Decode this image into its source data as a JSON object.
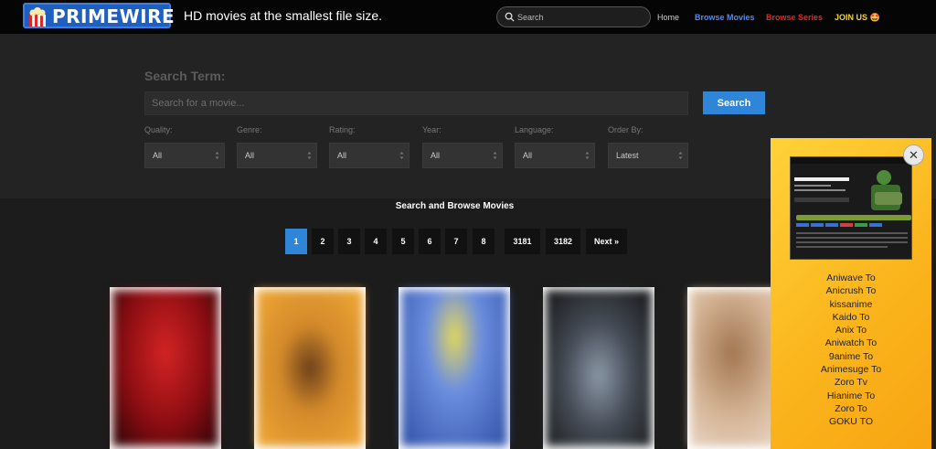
{
  "header": {
    "logo_text": "PRIMEWIRE",
    "tagline": "HD movies at the smallest file size.",
    "search_placeholder": "Search",
    "nav": {
      "home": "Home",
      "browse_movies": "Browse Movies",
      "browse_series": "Browse Series",
      "join": "JOIN US 🤩"
    }
  },
  "search_panel": {
    "term_label": "Search Term:",
    "term_placeholder": "Search for a movie...",
    "search_button": "Search",
    "filters": [
      {
        "label": "Quality:",
        "value": "All"
      },
      {
        "label": "Genre:",
        "value": "All"
      },
      {
        "label": "Rating:",
        "value": "All"
      },
      {
        "label": "Year:",
        "value": "All"
      },
      {
        "label": "Language:",
        "value": "All"
      },
      {
        "label": "Order By:",
        "value": "Latest"
      }
    ]
  },
  "browse": {
    "title": "Search and Browse Movies",
    "pages": [
      "1",
      "2",
      "3",
      "4",
      "5",
      "6",
      "7",
      "8",
      "3181",
      "3182",
      "Next »"
    ],
    "active_page": "1"
  },
  "posters": [
    {
      "color": "#b0141a"
    },
    {
      "color": "#e3a030"
    },
    {
      "color": "#4a6ec0"
    },
    {
      "color": "#556070"
    },
    {
      "color": "#c7a58a"
    }
  ],
  "popup": {
    "close_label": "✕",
    "links": [
      "Aniwave To",
      "Anicrush To",
      "kissanime",
      "Kaido To",
      "Anix To",
      "Aniwatch To",
      "9anime To",
      "Animesuge To",
      "Zoro Tv",
      "Hianime To",
      "Zoro To",
      "GOKU TO"
    ]
  },
  "colors": {
    "accent": "#2f85d8",
    "movies_link": "#4f8bff",
    "series_link": "#e02828",
    "join_link": "#f3d23a"
  }
}
